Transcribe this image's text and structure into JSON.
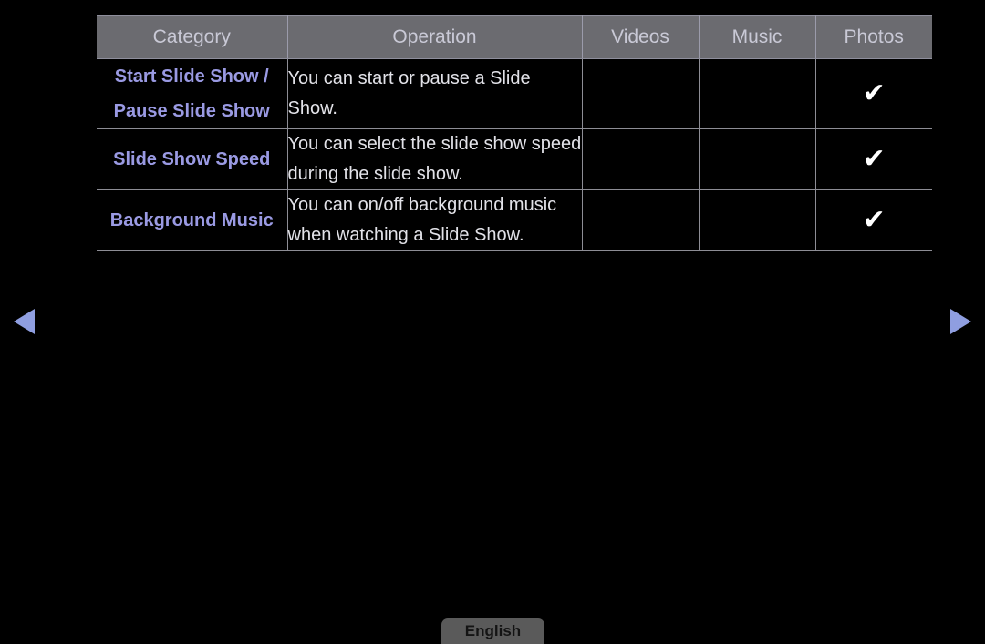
{
  "screen": {
    "background_color": "#000000",
    "accent_color": "#8f9ee0",
    "header_background_color": "#6b6b70",
    "category_text_color": "#9a9ae3",
    "operation_text_color": "#e2e2e8",
    "checkmark_color": "#ffffff"
  },
  "table": {
    "headers": [
      {
        "label": "Category"
      },
      {
        "label": "Operation"
      },
      {
        "label": "Videos"
      },
      {
        "label": "Music"
      },
      {
        "label": "Photos"
      }
    ],
    "rows": [
      {
        "category_lines": [
          "Start Slide Show /",
          "Pause Slide Show"
        ],
        "operation": "You can start or pause a Slide Show.",
        "videos": "",
        "music": "",
        "photos": "✔"
      },
      {
        "category_lines": [
          "Slide Show Speed"
        ],
        "operation": "You can select the slide show speed during the slide show.",
        "videos": "",
        "music": "",
        "photos": "✔"
      },
      {
        "category_lines": [
          "Background Music"
        ],
        "operation": "You can on/off background music when watching a Slide Show.",
        "videos": "",
        "music": "",
        "photos": "✔"
      }
    ]
  },
  "navigation": {
    "prev_icon": "triangle-left-icon",
    "next_icon": "triangle-right-icon"
  },
  "footer": {
    "language_label": "English"
  }
}
